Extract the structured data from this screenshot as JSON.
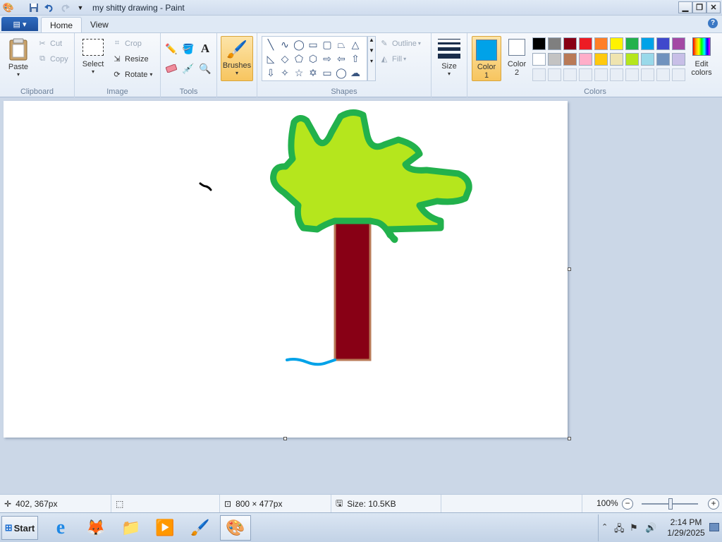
{
  "window": {
    "title": "my shitty drawing - Paint",
    "controls": [
      "minimize",
      "restore",
      "close"
    ]
  },
  "quick_access": [
    "save-icon",
    "undo-icon",
    "redo-icon",
    "customize-icon"
  ],
  "tabs": [
    {
      "label": "Home",
      "active": true
    },
    {
      "label": "View",
      "active": false
    }
  ],
  "ribbon": {
    "clipboard": {
      "group_label": "Clipboard",
      "paste": "Paste",
      "cut": "Cut",
      "copy": "Copy"
    },
    "image": {
      "group_label": "Image",
      "select": "Select",
      "crop": "Crop",
      "resize": "Resize",
      "rotate": "Rotate"
    },
    "tools": {
      "group_label": "Tools",
      "items": [
        "pencil-icon",
        "fill-icon",
        "text-icon",
        "eraser-icon",
        "color-picker-icon",
        "magnifier-icon"
      ]
    },
    "brushes": {
      "label": "Brushes"
    },
    "shapes": {
      "group_label": "Shapes",
      "outline": "Outline",
      "fill": "Fill"
    },
    "size": {
      "label": "Size"
    },
    "colors": {
      "group_label": "Colors",
      "color1_label": "Color",
      "color1_num": "1",
      "color1_value": "#00a2e8",
      "color2_label": "Color",
      "color2_num": "2",
      "color2_value": "#ffffff",
      "edit_colors_line1": "Edit",
      "edit_colors_line2": "colors",
      "palette_row1": [
        "#000000",
        "#7f7f7f",
        "#880015",
        "#ed1c24",
        "#ff7f27",
        "#fff200",
        "#22b14c",
        "#00a2e8",
        "#3f48cc",
        "#a349a4"
      ],
      "palette_row2": [
        "#ffffff",
        "#c3c3c3",
        "#b97a57",
        "#ffaec9",
        "#ffc90e",
        "#efe4b0",
        "#b5e61d",
        "#99d9ea",
        "#7092be",
        "#c8bfe7"
      ]
    }
  },
  "drawing": {
    "foliage_fill": "#b5e61d",
    "foliage_outline": "#22b14c",
    "trunk_fill": "#880015",
    "trunk_outline": "#b97a57",
    "water": "#00a2e8",
    "bird": "#000000"
  },
  "statusbar": {
    "cursor_pos": "402, 367px",
    "canvas_size": "800 × 477px",
    "file_size": "Size: 10.5KB",
    "zoom": "100%"
  },
  "taskbar": {
    "start": "Start",
    "apps": [
      "internet-explorer-icon",
      "firefox-icon",
      "file-explorer-icon",
      "media-player-icon",
      "brush-app-icon",
      "paint-icon"
    ],
    "time": "2:14 PM",
    "date": "1/29/2025"
  }
}
